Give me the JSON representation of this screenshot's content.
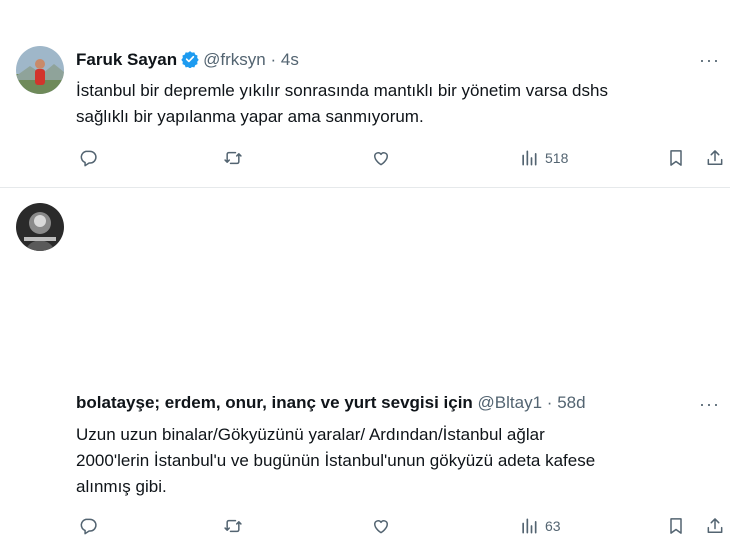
{
  "tweets": [
    {
      "name": "Faruk Sayan",
      "verified": true,
      "handle": "@frksyn",
      "separator": "·",
      "time": "4s",
      "text": "İstanbul bir depremle yıkılır sonrasında mantıklı bir yönetim varsa dshs\nsağlıklı bir yapılanma yapar ama sanmıyorum.",
      "views": "518",
      "more": "···"
    },
    {
      "name": "bolatayşe; erdem, onur, inanç ve yurt sevgisi için",
      "verified": false,
      "handle": "@Bltay1",
      "separator": "·",
      "time": "58d",
      "text": "Uzun uzun binalar/Gökyüzünü yaralar/ Ardından/İstanbul ağlar\n2000'lerin İstanbul'u ve bugünün İstanbul'unun  gökyüzü adeta kafese\nalınmış gibi.",
      "views": "63",
      "more": "···"
    }
  ],
  "colors": {
    "verified": "#1d9bf0",
    "muted": "#536471",
    "text": "#0f1419"
  },
  "icons": [
    "reply-icon",
    "retweet-icon",
    "like-icon",
    "views-icon",
    "bookmark-icon",
    "share-icon",
    "verified-badge-icon",
    "more-icon"
  ]
}
